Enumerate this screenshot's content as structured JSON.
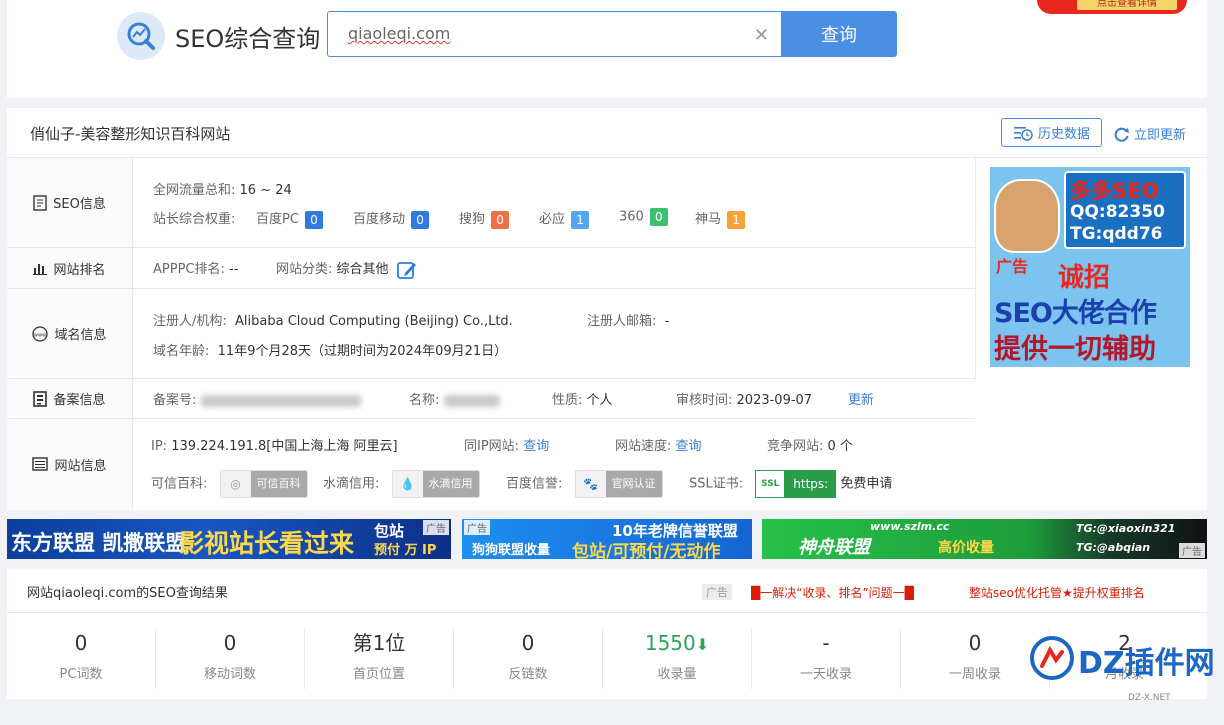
{
  "header": {
    "logo_text": "SEO综合查询",
    "search_value": "qiaoleqi.com",
    "search_button": "查询",
    "top_ad": "点击查看详情"
  },
  "panel": {
    "site_title": "俏仙子-美容整形知识百科网站",
    "history_button": "历史数据",
    "refresh_button": "立即更新",
    "seo": {
      "label": "SEO信息",
      "traffic_label": "全网流量总和:",
      "traffic_value": "16 ~ 24",
      "weight_label": "站长综合权重:",
      "weights": [
        {
          "name": "百度PC",
          "value": "0",
          "color": "#2f7be0"
        },
        {
          "name": "百度移动",
          "value": "0",
          "color": "#2f7be0"
        },
        {
          "name": "搜狗",
          "value": "0",
          "color": "#f07045"
        },
        {
          "name": "必应",
          "value": "1",
          "color": "#55a8f0"
        },
        {
          "name": "360",
          "value": "0",
          "color": "#3dbf70"
        },
        {
          "name": "神马",
          "value": "1",
          "color": "#f6a33a"
        }
      ]
    },
    "rank": {
      "label": "网站排名",
      "apppc_label": "APPPC排名:",
      "apppc_value": "--",
      "category_label": "网站分类:",
      "category_value": "综合其他"
    },
    "domain": {
      "label": "域名信息",
      "registrant_label": "注册人/机构:",
      "registrant_value": "Alibaba Cloud Computing (Beijing) Co.,Ltd.",
      "email_label": "注册人邮箱:",
      "email_value": "-",
      "age_label": "域名年龄:",
      "age_value": "11年9个月28天（过期时间为2024年09月21日）"
    },
    "icp": {
      "label": "备案信息",
      "number_label": "备案号:",
      "name_label": "名称:",
      "type_label": "性质:",
      "type_value": "个人",
      "audit_label": "审核时间:",
      "audit_value": "2023-09-07",
      "update_link": "更新"
    },
    "site": {
      "label": "网站信息",
      "ip_label": "IP:",
      "ip_value": "139.224.191.8[中国上海上海 阿里云]",
      "same_ip_label": "同IP网站:",
      "same_ip_link": "查询",
      "speed_label": "网站速度:",
      "speed_link": "查询",
      "competitor_label": "竞争网站:",
      "competitor_value": "0 个",
      "kexin_label": "可信百科:",
      "kexin_badge": "可信百科",
      "shuidi_label": "水滴信用:",
      "shuidi_badge": "水滴信用",
      "baidu_label": "百度信誉:",
      "baidu_badge": "官网认证",
      "ssl_label": "SSL证书:",
      "ssl_icon": "SSL",
      "ssl_badge": "https:",
      "ssl_apply": "免费申请"
    },
    "side_ad": {
      "line1": "多多SEO",
      "line2": "QQ:82350",
      "line3": "TG:qdd76",
      "tag": "广告",
      "line4": "诚招",
      "line5": "SEO大佬合作",
      "line6": "提供一切辅助"
    }
  },
  "banners": [
    {
      "a": "东方联盟 凯撒联盟",
      "b": "影视站长看过来",
      "c": "包站",
      "d": "预付 万 IP",
      "tag": "广告"
    },
    {
      "tag": "广告",
      "a": "10年老牌信誉联盟",
      "b": "狗狗联盟收量",
      "c": "包站/可预付/无动作"
    },
    {
      "a": "www.szlm.cc",
      "b": "神舟联盟",
      "c": "高价收量",
      "d": "TG:@xiaoxin321",
      "e": "TG:@abqian",
      "tag": "广告"
    }
  ],
  "results": {
    "title": "网站qiaoleqi.com的SEO查询结果",
    "ad_tag": "广告",
    "link1": "█一解决“收录、排名”问题一█",
    "link2": "整站seo优化托管★提升权重排名",
    "stats": [
      {
        "value": "0",
        "label": "PC词数"
      },
      {
        "value": "0",
        "label": "移动词数"
      },
      {
        "value": "第1位",
        "label": "首页位置"
      },
      {
        "value": "0",
        "label": "反链数"
      },
      {
        "value": "1550",
        "label": "收录量",
        "arrow": "⬇"
      },
      {
        "value": "-",
        "label": "一天收录"
      },
      {
        "value": "0",
        "label": "一周收录"
      },
      {
        "value": "2",
        "label": "月收录"
      }
    ]
  },
  "watermark": {
    "text": "DZ插件网",
    "sub": "DZ-X.NET"
  }
}
